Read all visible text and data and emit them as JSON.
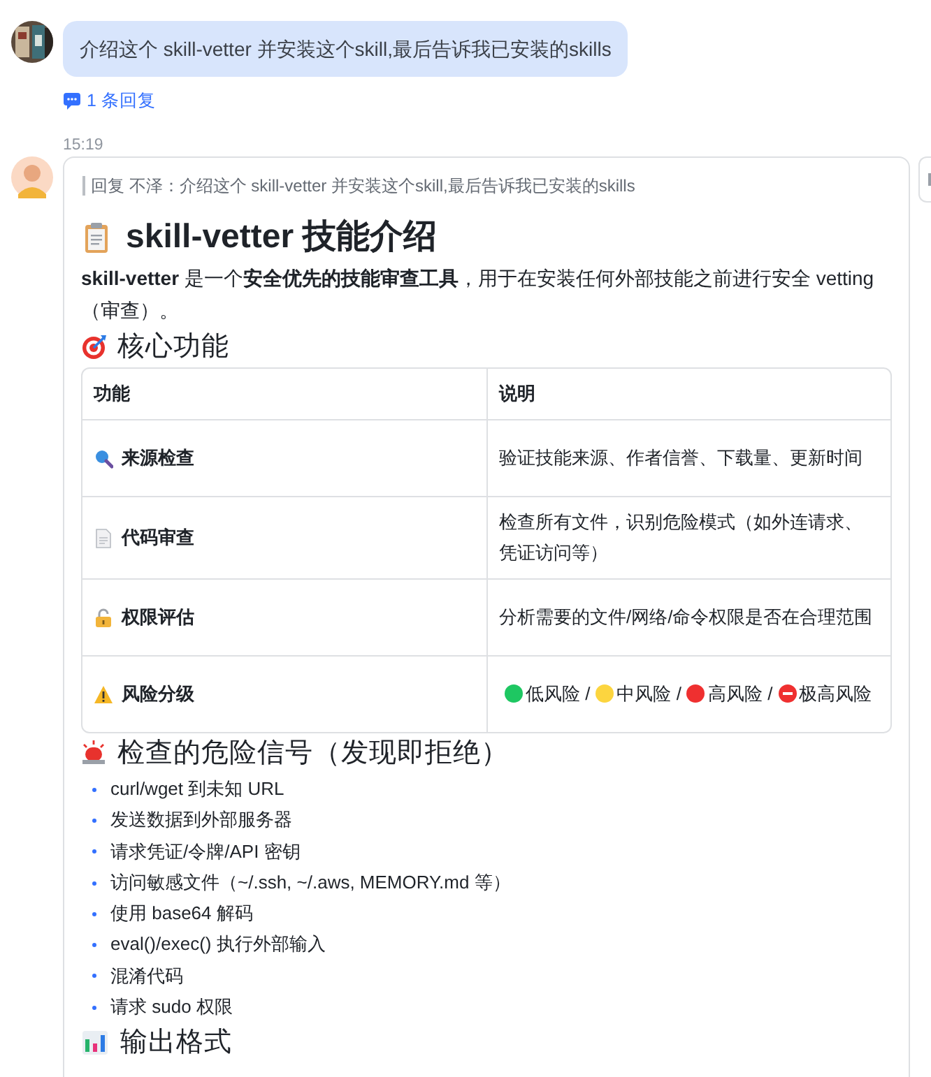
{
  "user_message": {
    "text": "介绍这个 skill-vetter 并安装这个skill,最后告诉我已安装的skills"
  },
  "thread": {
    "replies": "1 条回复"
  },
  "time": "15:19",
  "reply": {
    "quote": "回复 不泽：介绍这个 skill-vetter 并安装这个skill,最后告诉我已安装的skills",
    "title": "skill-vetter 技能介绍",
    "intro": "**skill-vetter** 是一个**安全优先的技能审查工具**，用于在安装任何外部技能之前进行安全 vetting（审查）。",
    "sections": [
      {
        "heading": "核心功能",
        "kind": "table",
        "columns": [
          "功能",
          "说明"
        ],
        "rows": [
          {
            "feature": "来源检查",
            "kind": "text",
            "description": "验证技能来源、作者信誉、下载量、更新时间"
          },
          {
            "feature": "代码审查",
            "kind": "text",
            "description": "检查所有文件，识别危险模式（如外连请求、凭证访问等）"
          },
          {
            "feature": "权限评估",
            "kind": "text",
            "description": "分析需要的文件/网络/命令权限是否在合理范围"
          },
          {
            "feature": "风险分级",
            "kind": "risk",
            "levels": [
              {
                "label": "低风险 /",
                "kind": "dot",
                "color": "#1ec762"
              },
              {
                "label": "中风险 /",
                "kind": "dot",
                "color": "#fcd53f"
              },
              {
                "label": "高风险 /",
                "kind": "dot",
                "color": "#ef3030"
              },
              {
                "label": "极高风险",
                "kind": "no-entry",
                "color": "#ef3030"
              }
            ]
          }
        ]
      },
      {
        "heading": "检查的危险信号（发现即拒绝）",
        "kind": "list",
        "items": [
          "curl/wget 到未知 URL",
          "发送数据到外部服务器",
          "请求凭证/令牌/API 密钥",
          "访问敏感文件（~/.ssh, ~/.aws, MEMORY.md 等）",
          "使用 base64 解码",
          "eval()/exec() 执行外部输入",
          "混淆代码",
          "请求 sudo 权限"
        ]
      },
      {
        "heading": "输出格式",
        "kind": "end"
      }
    ]
  }
}
